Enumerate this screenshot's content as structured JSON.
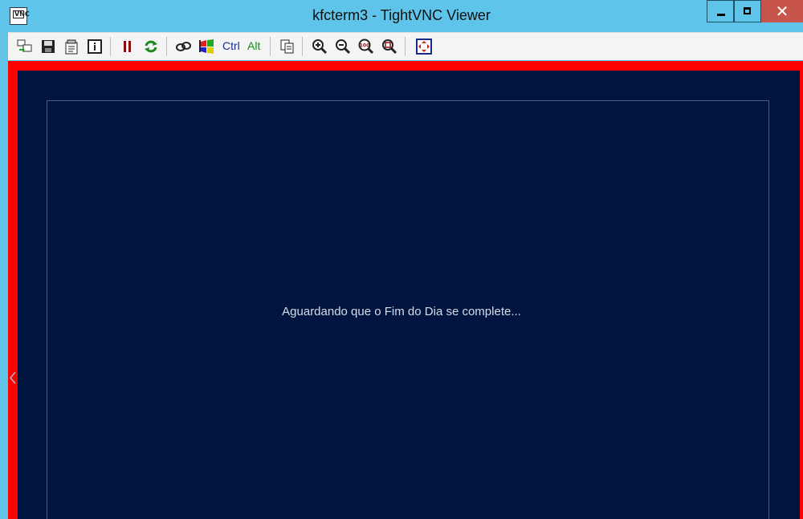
{
  "window": {
    "title": "kfcterm3 - TightVNC Viewer",
    "app_icon": "vnc-app-icon",
    "app_icon_text": "VNC",
    "controls": {
      "minimize": "minimize",
      "maximize": "maximize",
      "close": "✕"
    }
  },
  "toolbar": {
    "buttons": [
      {
        "icon": "new-connection-icon"
      },
      {
        "icon": "save-icon"
      },
      {
        "icon": "options-icon"
      },
      {
        "icon": "connection-info-icon"
      },
      {
        "icon": "pause-icon"
      },
      {
        "icon": "refresh-icon"
      },
      {
        "icon": "ctrl-alt-del-icon"
      },
      {
        "icon": "send-ctrl-esc-icon"
      },
      {
        "icon": "transfer-files-icon"
      },
      {
        "icon": "zoom-in-icon"
      },
      {
        "icon": "zoom-out-icon"
      },
      {
        "icon": "zoom-100-icon"
      },
      {
        "icon": "zoom-auto-icon"
      },
      {
        "icon": "fullscreen-icon"
      }
    ],
    "ctrl_label": "Ctrl",
    "alt_label": "Alt",
    "zoom_100_label": "100"
  },
  "remote": {
    "message": "Aguardando que o Fim do Dia se complete...",
    "background": "#001440",
    "border_color": "#ff0000"
  }
}
